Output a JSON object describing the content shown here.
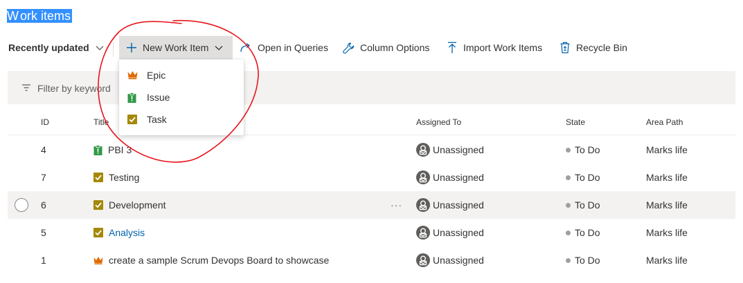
{
  "page": {
    "title_selected": "W",
    "title_rest": "ork items"
  },
  "toolbar": {
    "recently_updated": "Recently updated",
    "new_work_item": "New Work Item",
    "open_in_queries": "Open in Queries",
    "column_options": "Column Options",
    "import_work_items": "Import Work Items",
    "recycle_bin": "Recycle Bin"
  },
  "filter": {
    "placeholder": "Filter by keyword"
  },
  "dropdown": {
    "items": [
      {
        "label": "Epic",
        "icon": "crown-icon",
        "color": "#e06c00"
      },
      {
        "label": "Issue",
        "icon": "clipboard-icon",
        "color": "#339947"
      },
      {
        "label": "Task",
        "icon": "checkbox-icon",
        "color": "#a4880a"
      }
    ]
  },
  "table": {
    "columns": {
      "id": "ID",
      "title": "Title",
      "assigned_to": "Assigned To",
      "state": "State",
      "area_path": "Area Path"
    },
    "rows": [
      {
        "id": "4",
        "type": "Issue",
        "title": "PBI 3",
        "assigned": "Unassigned",
        "state": "To Do",
        "area": "Marks life"
      },
      {
        "id": "7",
        "type": "Task",
        "title": "Testing",
        "assigned": "Unassigned",
        "state": "To Do",
        "area": "Marks life"
      },
      {
        "id": "6",
        "type": "Task",
        "title": "Development",
        "more": "···",
        "assigned": "Unassigned",
        "state": "To Do",
        "area": "Marks life"
      },
      {
        "id": "5",
        "type": "Task",
        "title": "Analysis",
        "assigned": "Unassigned",
        "state": "To Do",
        "area": "Marks life"
      },
      {
        "id": "1",
        "type": "Epic",
        "title": "create a sample Scrum Devops Board to showcase",
        "assigned": "Unassigned",
        "state": "To Do",
        "area": "Marks life"
      }
    ]
  },
  "colors": {
    "epic": "#e06c00",
    "issue": "#339947",
    "task": "#a4880a",
    "link": "#0062ad",
    "annotation": "#e8141c",
    "selection": "#3390ff"
  }
}
